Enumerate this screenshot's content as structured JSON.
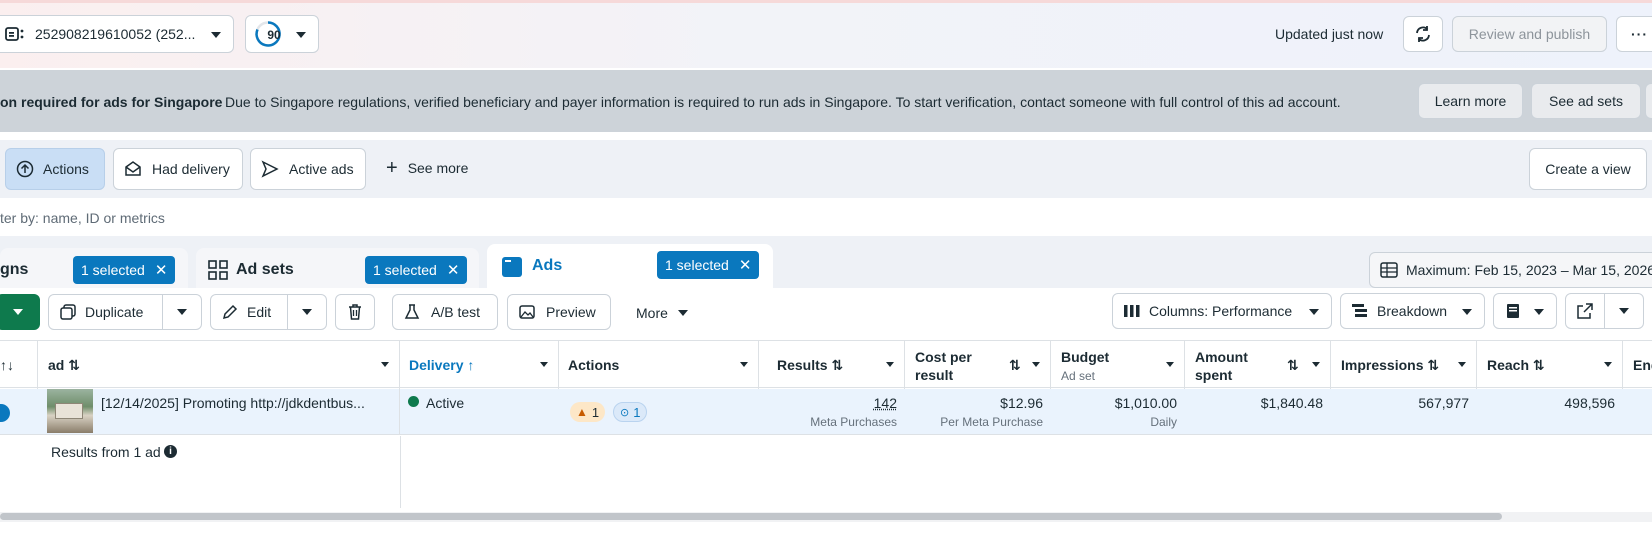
{
  "topbar": {
    "account_id": "252908219610052 (252...",
    "score": "90",
    "updated": "Updated just now",
    "review_label": "Review and publish"
  },
  "banner": {
    "title": "on required for ads for Singapore",
    "message": "Due to Singapore regulations, verified beneficiary and payer information is required to run ads in Singapore. To start verification, contact someone with full control of this ad account.",
    "learn_more": "Learn more",
    "see_ad_sets": "See ad sets"
  },
  "filters": {
    "actions": "Actions",
    "had_delivery": "Had delivery",
    "active_ads": "Active ads",
    "see_more": "See more",
    "create_view": "Create a view"
  },
  "search": {
    "placeholder": "ter by: name, ID or metrics"
  },
  "tabs": {
    "campaigns": "gns",
    "ad_sets": "Ad sets",
    "ads": "Ads",
    "selected": "1 selected",
    "date_range": "Maximum: Feb 15, 2023 – Mar 15, 2026"
  },
  "toolbar": {
    "duplicate": "Duplicate",
    "edit": "Edit",
    "ab_test": "A/B test",
    "preview": "Preview",
    "more": "More",
    "columns": "Columns: Performance",
    "breakdown": "Breakdown"
  },
  "table": {
    "headers": {
      "ad": "ad",
      "delivery": "Delivery",
      "actions": "Actions",
      "results": "Results",
      "cost_per_result_1": "Cost per",
      "cost_per_result_2": "result",
      "budget": "Budget",
      "budget_sub": "Ad set",
      "amount_spent_1": "Amount",
      "amount_spent_2": "spent",
      "impressions": "Impressions",
      "reach": "Reach",
      "ends": "End"
    },
    "row": {
      "ad_name": "[12/14/2025] Promoting http://jdkdentbus...",
      "delivery": "Active",
      "warn_count": "1",
      "info_count": "1",
      "results": "142",
      "results_sub": "Meta Purchases",
      "cost": "$12.96",
      "cost_sub": "Per Meta Purchase",
      "budget": "$1,010.00",
      "budget_sub": "Daily",
      "amount": "$1,840.48",
      "impressions": "567,977",
      "reach": "498,596"
    },
    "footer": "Results from 1 ad"
  },
  "colors": {
    "accent": "#0a78be",
    "active_dot": "#0e7a4d",
    "green_btn": "#0e7a4d"
  }
}
